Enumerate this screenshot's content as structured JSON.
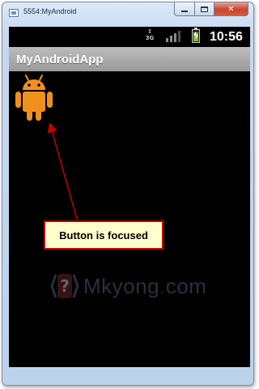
{
  "window": {
    "title": "5554:MyAndroid",
    "controls": {
      "minimize": "",
      "maximize": "",
      "close": "✕"
    }
  },
  "statusbar": {
    "network": "3G",
    "network_arrows": "↕",
    "signal_bars_filled": 3,
    "battery_state": "charging",
    "battery_level": 0.7,
    "time": "10:56"
  },
  "actionbar": {
    "title": "MyAndroidApp"
  },
  "content": {
    "android_button_icon": "android-robot-icon",
    "callout_text": "Button is focused"
  },
  "watermark": {
    "icon": "mkyong-logo-icon",
    "text_a": "Mkyong",
    "text_dot": ".",
    "text_b": "com"
  },
  "colors": {
    "android_orange": "#f0901c",
    "callout_border": "#c40000",
    "callout_bg": "#ffffcc",
    "arrow": "#c40000"
  }
}
